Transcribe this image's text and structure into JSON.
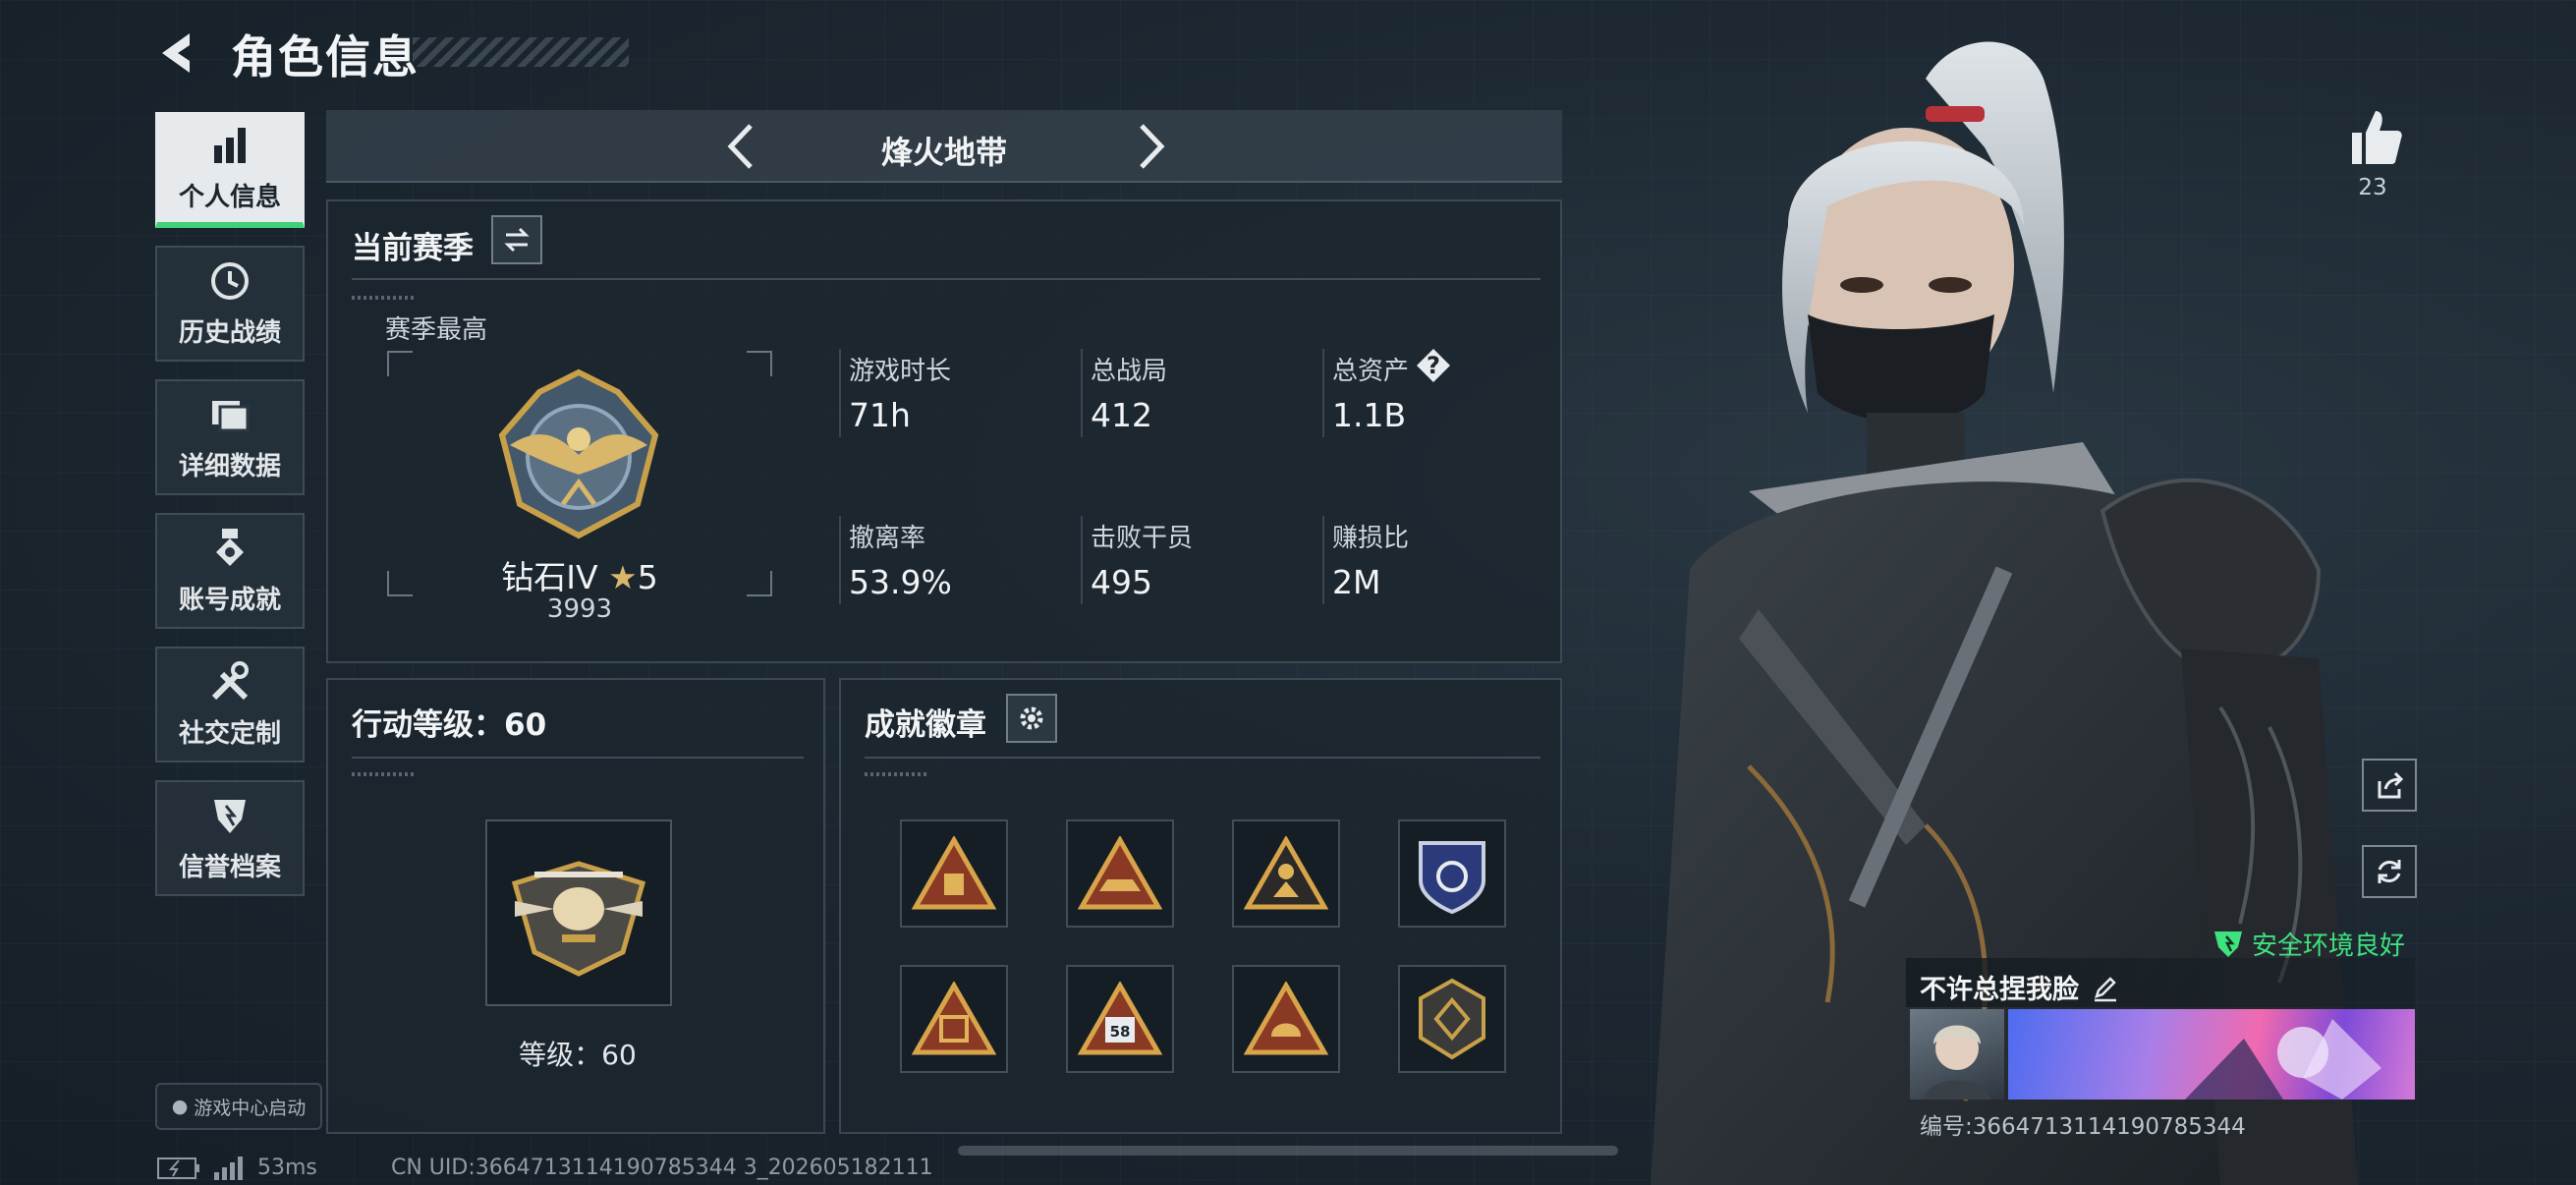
{
  "header": {
    "title": "角色信息"
  },
  "sidebar": {
    "items": [
      {
        "label": "个人信息",
        "icon": "bar-chart-icon",
        "active": true
      },
      {
        "label": "历史战绩",
        "icon": "history-icon",
        "active": false
      },
      {
        "label": "详细数据",
        "icon": "folders-icon",
        "active": false
      },
      {
        "label": "账号成就",
        "icon": "medal-icon",
        "active": false
      },
      {
        "label": "社交定制",
        "icon": "tools-icon",
        "active": false
      },
      {
        "label": "信誉档案",
        "icon": "shield-emblem-icon",
        "active": false
      }
    ],
    "game_center": "游戏中心启动"
  },
  "mode_selector": {
    "title": "烽火地带"
  },
  "season": {
    "title": "当前赛季",
    "best_label": "赛季最高",
    "rank_name": "钻石IV",
    "rank_stars": "5",
    "rank_points": "3993",
    "stats": [
      {
        "label": "游戏时长",
        "value": "71h"
      },
      {
        "label": "总战局",
        "value": "412"
      },
      {
        "label": "总资产",
        "value": "1.1B",
        "help": "?"
      },
      {
        "label": "撤离率",
        "value": "53.9%"
      },
      {
        "label": "击败干员",
        "value": "495"
      },
      {
        "label": "赚损比",
        "value": "2M"
      }
    ]
  },
  "action_level": {
    "title": "行动等级：60",
    "level_text": "等级：60"
  },
  "achievements": {
    "title": "成就徽章",
    "badges": [
      "triangle-gold-badge",
      "triangle-ship-badge",
      "triangle-figure-badge",
      "blue-shield-badge",
      "triangle-bag-badge",
      "triangle-58-badge",
      "triangle-helmet-badge",
      "hex-emblem-badge"
    ],
    "badge_text_58": "58"
  },
  "right_panel": {
    "like_count": "23",
    "safe_env": "安全环境良好",
    "player_name": "不许总捏我脸",
    "player_id": "编号:3664713114190785344"
  },
  "status_bar": {
    "ping": "53ms",
    "uid": "CN UID:3664713114190785344 3_202605182111"
  },
  "colors": {
    "accent_green": "#3fd07a",
    "safe_green": "#3ee27f",
    "gold": "#c9a04a"
  }
}
